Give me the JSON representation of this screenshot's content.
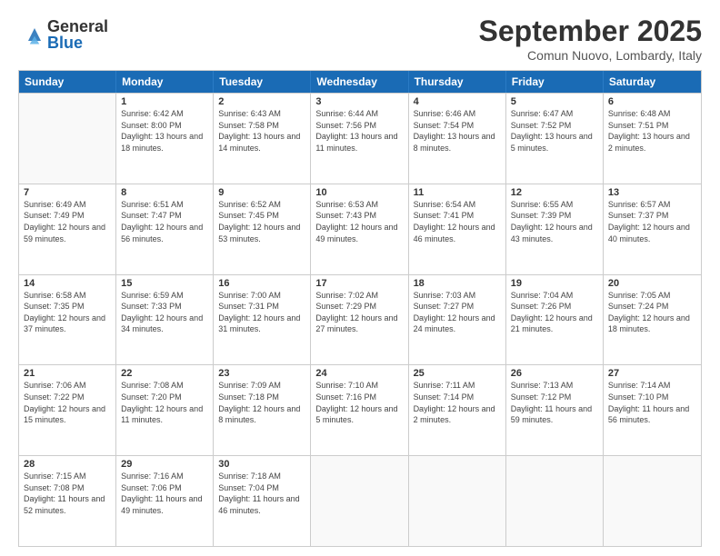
{
  "logo": {
    "general": "General",
    "blue": "Blue"
  },
  "title": "September 2025",
  "location": "Comun Nuovo, Lombardy, Italy",
  "weekdays": [
    "Sunday",
    "Monday",
    "Tuesday",
    "Wednesday",
    "Thursday",
    "Friday",
    "Saturday"
  ],
  "weeks": [
    [
      {
        "day": "",
        "empty": true
      },
      {
        "day": "1",
        "sunrise": "6:42 AM",
        "sunset": "8:00 PM",
        "daylight": "13 hours and 18 minutes."
      },
      {
        "day": "2",
        "sunrise": "6:43 AM",
        "sunset": "7:58 PM",
        "daylight": "13 hours and 14 minutes."
      },
      {
        "day": "3",
        "sunrise": "6:44 AM",
        "sunset": "7:56 PM",
        "daylight": "13 hours and 11 minutes."
      },
      {
        "day": "4",
        "sunrise": "6:46 AM",
        "sunset": "7:54 PM",
        "daylight": "13 hours and 8 minutes."
      },
      {
        "day": "5",
        "sunrise": "6:47 AM",
        "sunset": "7:52 PM",
        "daylight": "13 hours and 5 minutes."
      },
      {
        "day": "6",
        "sunrise": "6:48 AM",
        "sunset": "7:51 PM",
        "daylight": "13 hours and 2 minutes."
      }
    ],
    [
      {
        "day": "7",
        "sunrise": "6:49 AM",
        "sunset": "7:49 PM",
        "daylight": "12 hours and 59 minutes."
      },
      {
        "day": "8",
        "sunrise": "6:51 AM",
        "sunset": "7:47 PM",
        "daylight": "12 hours and 56 minutes."
      },
      {
        "day": "9",
        "sunrise": "6:52 AM",
        "sunset": "7:45 PM",
        "daylight": "12 hours and 53 minutes."
      },
      {
        "day": "10",
        "sunrise": "6:53 AM",
        "sunset": "7:43 PM",
        "daylight": "12 hours and 49 minutes."
      },
      {
        "day": "11",
        "sunrise": "6:54 AM",
        "sunset": "7:41 PM",
        "daylight": "12 hours and 46 minutes."
      },
      {
        "day": "12",
        "sunrise": "6:55 AM",
        "sunset": "7:39 PM",
        "daylight": "12 hours and 43 minutes."
      },
      {
        "day": "13",
        "sunrise": "6:57 AM",
        "sunset": "7:37 PM",
        "daylight": "12 hours and 40 minutes."
      }
    ],
    [
      {
        "day": "14",
        "sunrise": "6:58 AM",
        "sunset": "7:35 PM",
        "daylight": "12 hours and 37 minutes."
      },
      {
        "day": "15",
        "sunrise": "6:59 AM",
        "sunset": "7:33 PM",
        "daylight": "12 hours and 34 minutes."
      },
      {
        "day": "16",
        "sunrise": "7:00 AM",
        "sunset": "7:31 PM",
        "daylight": "12 hours and 31 minutes."
      },
      {
        "day": "17",
        "sunrise": "7:02 AM",
        "sunset": "7:29 PM",
        "daylight": "12 hours and 27 minutes."
      },
      {
        "day": "18",
        "sunrise": "7:03 AM",
        "sunset": "7:27 PM",
        "daylight": "12 hours and 24 minutes."
      },
      {
        "day": "19",
        "sunrise": "7:04 AM",
        "sunset": "7:26 PM",
        "daylight": "12 hours and 21 minutes."
      },
      {
        "day": "20",
        "sunrise": "7:05 AM",
        "sunset": "7:24 PM",
        "daylight": "12 hours and 18 minutes."
      }
    ],
    [
      {
        "day": "21",
        "sunrise": "7:06 AM",
        "sunset": "7:22 PM",
        "daylight": "12 hours and 15 minutes."
      },
      {
        "day": "22",
        "sunrise": "7:08 AM",
        "sunset": "7:20 PM",
        "daylight": "12 hours and 11 minutes."
      },
      {
        "day": "23",
        "sunrise": "7:09 AM",
        "sunset": "7:18 PM",
        "daylight": "12 hours and 8 minutes."
      },
      {
        "day": "24",
        "sunrise": "7:10 AM",
        "sunset": "7:16 PM",
        "daylight": "12 hours and 5 minutes."
      },
      {
        "day": "25",
        "sunrise": "7:11 AM",
        "sunset": "7:14 PM",
        "daylight": "12 hours and 2 minutes."
      },
      {
        "day": "26",
        "sunrise": "7:13 AM",
        "sunset": "7:12 PM",
        "daylight": "11 hours and 59 minutes."
      },
      {
        "day": "27",
        "sunrise": "7:14 AM",
        "sunset": "7:10 PM",
        "daylight": "11 hours and 56 minutes."
      }
    ],
    [
      {
        "day": "28",
        "sunrise": "7:15 AM",
        "sunset": "7:08 PM",
        "daylight": "11 hours and 52 minutes."
      },
      {
        "day": "29",
        "sunrise": "7:16 AM",
        "sunset": "7:06 PM",
        "daylight": "11 hours and 49 minutes."
      },
      {
        "day": "30",
        "sunrise": "7:18 AM",
        "sunset": "7:04 PM",
        "daylight": "11 hours and 46 minutes."
      },
      {
        "day": "",
        "empty": true
      },
      {
        "day": "",
        "empty": true
      },
      {
        "day": "",
        "empty": true
      },
      {
        "day": "",
        "empty": true
      }
    ]
  ],
  "labels": {
    "sunrise": "Sunrise:",
    "sunset": "Sunset:",
    "daylight": "Daylight:"
  }
}
